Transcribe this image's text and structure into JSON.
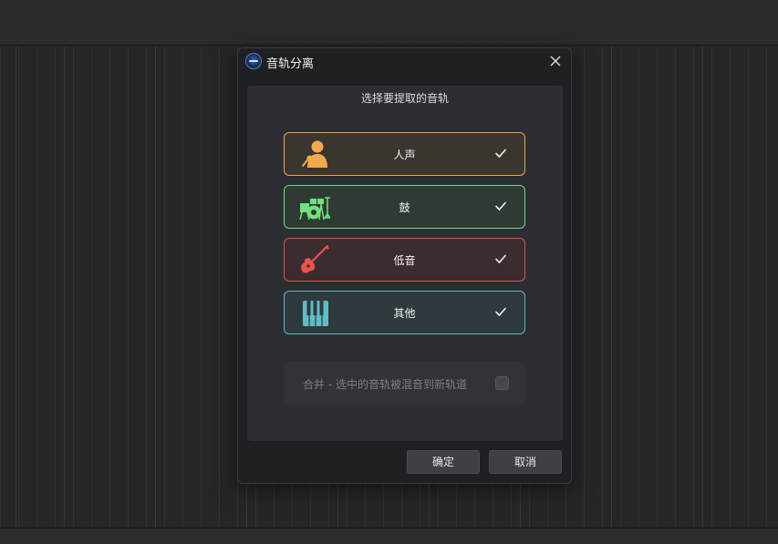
{
  "dialog": {
    "title": "音轨分离",
    "panel_title": "选择要提取的音轨",
    "stems": [
      {
        "label": "人声",
        "icon": "singer-icon",
        "color": "#e8a64c",
        "checked": true
      },
      {
        "label": "鼓",
        "icon": "drum-kit-icon",
        "color": "#6fdc7c",
        "checked": true
      },
      {
        "label": "低音",
        "icon": "bass-guitar-icon",
        "color": "#e0504e",
        "checked": true
      },
      {
        "label": "其他",
        "icon": "piano-keys-icon",
        "color": "#5fb8c4",
        "checked": true
      }
    ],
    "merge": {
      "label": "合并 - 选中的音轨被混音到新轨道",
      "checked": false
    },
    "buttons": {
      "ok": "确定",
      "cancel": "取消"
    }
  }
}
